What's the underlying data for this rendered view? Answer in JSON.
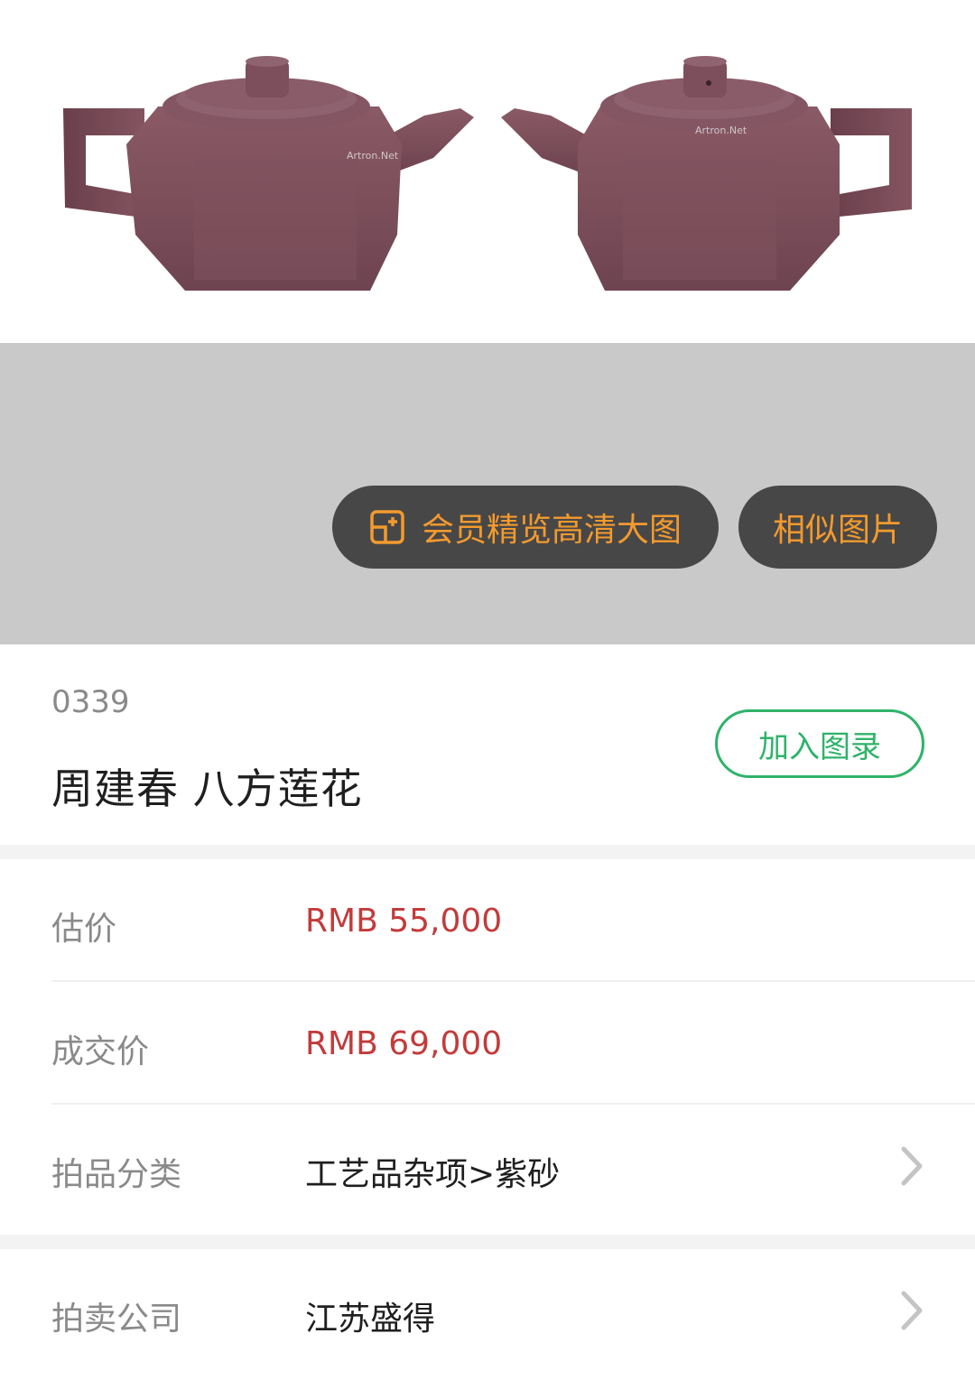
{
  "image": {
    "watermark_left": "Artron.Net",
    "watermark_right": "Artron.Net"
  },
  "buttons": {
    "hd_view_label": "会员精览高清大图",
    "similar_label": "相似图片"
  },
  "lot": {
    "number": "0339",
    "title": "周建春 八方莲花",
    "add_catalog_label": "加入图录"
  },
  "details": {
    "estimate_label": "估价",
    "estimate_value": "RMB 55,000",
    "sold_label": "成交价",
    "sold_value": "RMB 69,000",
    "category_label": "拍品分类",
    "category_value": "工艺品杂项>紫砂",
    "company_label": "拍卖公司",
    "company_value": "江苏盛得"
  },
  "colors": {
    "accent_orange": "#f39a2e",
    "accent_green": "#2fb36a",
    "price_red": "#c33b3b",
    "clay": "#7a4a55"
  }
}
